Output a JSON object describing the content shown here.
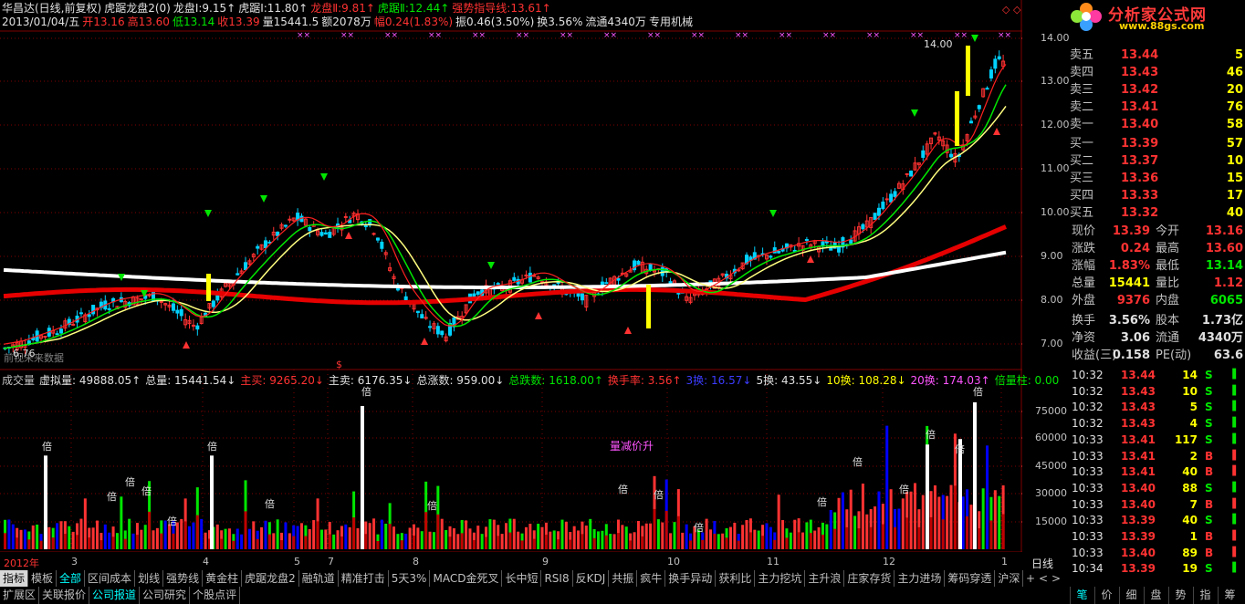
{
  "header": {
    "line1": [
      {
        "text": "华昌达(日线,前复权)",
        "color": "#e0e0e0"
      },
      {
        "text": "虎踞龙盘2(0)",
        "color": "#e0e0e0"
      },
      {
        "text": "龙盘Ⅰ:9.15↑",
        "color": "#e0e0e0"
      },
      {
        "text": "虎踞Ⅰ:11.80↑",
        "color": "#e0e0e0"
      },
      {
        "text": "龙盘Ⅱ:9.81↑",
        "color": "#ff3232"
      },
      {
        "text": "虎踞Ⅱ:12.44↑",
        "color": "#00e600"
      },
      {
        "text": "强势指导线:13.61↑",
        "color": "#ff3232"
      }
    ],
    "line2": [
      {
        "text": "2013/01/04/五",
        "color": "#e0e0e0"
      },
      {
        "text": "开13.16",
        "color": "#ff3232"
      },
      {
        "text": "高13.60",
        "color": "#ff3232"
      },
      {
        "text": "低13.14",
        "color": "#00e600"
      },
      {
        "text": "收13.39",
        "color": "#ff3232"
      },
      {
        "text": "量15441.5",
        "color": "#e0e0e0"
      },
      {
        "text": "额2078万",
        "color": "#e0e0e0"
      },
      {
        "text": "幅0.24(1.83%)",
        "color": "#ff3232"
      },
      {
        "text": "振0.46(3.50%)",
        "color": "#e0e0e0"
      },
      {
        "text": "换3.56%",
        "color": "#e0e0e0"
      },
      {
        "text": "流通4340万",
        "color": "#e0e0e0"
      },
      {
        "text": "专用机械",
        "color": "#e0e0e0"
      }
    ],
    "no_data_label": "前视未来数据",
    "max_label": "14.00",
    "min_label": "6.76",
    "dollar_mark": "$"
  },
  "logo": {
    "title": "分析家公式网",
    "url": "www.88gs.com"
  },
  "price_axis": [
    "14.00",
    "13.00",
    "12.00",
    "11.00",
    "10.00",
    "9.00",
    "8.00",
    "7.00"
  ],
  "volume_header": [
    {
      "text": "成交量",
      "color": "#c0c0c0"
    },
    {
      "text": "虚拟量: 49888.05↑",
      "color": "#e0e0e0"
    },
    {
      "text": "总量: 15441.54↓",
      "color": "#e0e0e0"
    },
    {
      "text": "主买: 9265.20↓",
      "color": "#ff3232"
    },
    {
      "text": "主卖: 6176.35↓",
      "color": "#e0e0e0"
    },
    {
      "text": "总涨数: 959.00↓",
      "color": "#e0e0e0"
    },
    {
      "text": "总跌数: 1618.00↑",
      "color": "#00e600"
    },
    {
      "text": "换手率: 3.56↑",
      "color": "#ff3232"
    },
    {
      "text": "3换: 16.57↓",
      "color": "#3c3cff"
    },
    {
      "text": "5换: 43.55↓",
      "color": "#e0e0e0"
    },
    {
      "text": "10换: 108.28↓",
      "color": "#ffff00"
    },
    {
      "text": "20换: 174.03↑",
      "color": "#ff55ff"
    },
    {
      "text": "倍量柱: 0.00",
      "color": "#00e600"
    }
  ],
  "volume_axis": [
    "75000",
    "60000",
    "45000",
    "30000",
    "15000"
  ],
  "volume_note": "量减价升",
  "bei_label": "倍",
  "time_axis": [
    {
      "label": "2012年",
      "color": "#ff3232"
    },
    {
      "label": "3",
      "color": "#c0c0c0"
    },
    {
      "label": "4",
      "color": "#c0c0c0"
    },
    {
      "label": "5",
      "color": "#c0c0c0"
    },
    {
      "label": "7",
      "color": "#c0c0c0"
    },
    {
      "label": "8",
      "color": "#c0c0c0"
    },
    {
      "label": "9",
      "color": "#c0c0c0"
    },
    {
      "label": "10",
      "color": "#c0c0c0"
    },
    {
      "label": "11",
      "color": "#c0c0c0"
    },
    {
      "label": "12",
      "color": "#c0c0c0"
    },
    {
      "label": "1",
      "color": "#c0c0c0"
    }
  ],
  "period_label": "日线",
  "sell_orders": [
    {
      "label": "卖五",
      "price": "13.44",
      "vol": "5"
    },
    {
      "label": "卖四",
      "price": "13.43",
      "vol": "46"
    },
    {
      "label": "卖三",
      "price": "13.42",
      "vol": "20"
    },
    {
      "label": "卖二",
      "price": "13.41",
      "vol": "76"
    },
    {
      "label": "卖一",
      "price": "13.40",
      "vol": "58"
    }
  ],
  "buy_orders": [
    {
      "label": "买一",
      "price": "13.39",
      "vol": "57"
    },
    {
      "label": "买二",
      "price": "13.37",
      "vol": "10"
    },
    {
      "label": "买三",
      "price": "13.36",
      "vol": "15"
    },
    {
      "label": "买四",
      "price": "13.33",
      "vol": "17"
    },
    {
      "label": "买五",
      "price": "13.32",
      "vol": "40"
    }
  ],
  "stats": [
    {
      "a": "现价",
      "b": "13.39",
      "bc": "#ff3232",
      "c": "今开",
      "d": "13.16",
      "dc": "#ff3232"
    },
    {
      "a": "涨跌",
      "b": "0.24",
      "bc": "#ff3232",
      "c": "最高",
      "d": "13.60",
      "dc": "#ff3232"
    },
    {
      "a": "涨幅",
      "b": "1.83%",
      "bc": "#ff3232",
      "c": "最低",
      "d": "13.14",
      "dc": "#00e600"
    },
    {
      "a": "总量",
      "b": "15441",
      "bc": "#ffff00",
      "c": "量比",
      "d": "1.12",
      "dc": "#ff3232"
    },
    {
      "a": "外盘",
      "b": "9376",
      "bc": "#ff3232",
      "c": "内盘",
      "d": "6065",
      "dc": "#00e600"
    }
  ],
  "stats2": [
    {
      "a": "换手",
      "b": "3.56%",
      "bc": "#e0e0e0",
      "c": "股本",
      "d": "1.73亿",
      "dc": "#e0e0e0"
    },
    {
      "a": "净资",
      "b": "3.06",
      "bc": "#e0e0e0",
      "c": "流通",
      "d": "4340万",
      "dc": "#e0e0e0"
    },
    {
      "a": "收益(三)",
      "b": "0.158",
      "bc": "#e0e0e0",
      "c": "PE(动)",
      "d": "63.6",
      "dc": "#e0e0e0"
    }
  ],
  "ticks": [
    {
      "t": "10:32",
      "p": "13.44",
      "pc": "#ff3232",
      "v": "14",
      "s": "S",
      "sc": "#00e600"
    },
    {
      "t": "10:32",
      "p": "13.43",
      "pc": "#ff3232",
      "v": "10",
      "s": "S",
      "sc": "#00e600"
    },
    {
      "t": "10:32",
      "p": "13.43",
      "pc": "#ff3232",
      "v": "5",
      "s": "S",
      "sc": "#00e600"
    },
    {
      "t": "10:32",
      "p": "13.43",
      "pc": "#ff3232",
      "v": "4",
      "s": "S",
      "sc": "#00e600"
    },
    {
      "t": "10:33",
      "p": "13.41",
      "pc": "#ff3232",
      "v": "117",
      "s": "S",
      "sc": "#00e600"
    },
    {
      "t": "10:33",
      "p": "13.41",
      "pc": "#ff3232",
      "v": "2",
      "s": "B",
      "sc": "#ff3232"
    },
    {
      "t": "10:33",
      "p": "13.41",
      "pc": "#ff3232",
      "v": "40",
      "s": "B",
      "sc": "#ff3232"
    },
    {
      "t": "10:33",
      "p": "13.40",
      "pc": "#ff3232",
      "v": "88",
      "s": "S",
      "sc": "#00e600"
    },
    {
      "t": "10:33",
      "p": "13.40",
      "pc": "#ff3232",
      "v": "7",
      "s": "B",
      "sc": "#ff3232"
    },
    {
      "t": "10:33",
      "p": "13.39",
      "pc": "#ff3232",
      "v": "40",
      "s": "S",
      "sc": "#00e600"
    },
    {
      "t": "10:33",
      "p": "13.39",
      "pc": "#ff3232",
      "v": "1",
      "s": "B",
      "sc": "#ff3232"
    },
    {
      "t": "10:33",
      "p": "13.40",
      "pc": "#ff3232",
      "v": "89",
      "s": "B",
      "sc": "#ff3232"
    },
    {
      "t": "10:34",
      "p": "13.39",
      "pc": "#ff3232",
      "v": "19",
      "s": "S",
      "sc": "#00e600"
    }
  ],
  "tabs": [
    {
      "label": "指标",
      "active": true,
      "hl": false
    },
    {
      "label": "模板",
      "active": false,
      "hl": false
    },
    {
      "label": "全部",
      "active": false,
      "hl": true
    },
    {
      "label": "区间成本",
      "active": false,
      "hl": false
    },
    {
      "label": "划线",
      "active": false,
      "hl": false
    },
    {
      "label": "强势线",
      "active": false,
      "hl": false
    },
    {
      "label": "黄金柱",
      "active": false,
      "hl": false
    },
    {
      "label": "虎踞龙盘2",
      "active": false,
      "hl": false
    },
    {
      "label": "融轨道",
      "active": false,
      "hl": false
    },
    {
      "label": "精准打击",
      "active": false,
      "hl": false
    },
    {
      "label": "5天3%",
      "active": false,
      "hl": false
    },
    {
      "label": "MACD金死叉",
      "active": false,
      "hl": false
    },
    {
      "label": "长中短",
      "active": false,
      "hl": false
    },
    {
      "label": "RSI8",
      "active": false,
      "hl": false
    },
    {
      "label": "反KDJ",
      "active": false,
      "hl": false
    },
    {
      "label": "共振",
      "active": false,
      "hl": false
    },
    {
      "label": "疯牛",
      "active": false,
      "hl": false
    },
    {
      "label": "换手异动",
      "active": false,
      "hl": false
    },
    {
      "label": "获利比",
      "active": false,
      "hl": false
    },
    {
      "label": "主力挖坑",
      "active": false,
      "hl": false
    },
    {
      "label": "主升浪",
      "active": false,
      "hl": false
    },
    {
      "label": "庄家存货",
      "active": false,
      "hl": false
    },
    {
      "label": "主力进场",
      "active": false,
      "hl": false
    },
    {
      "label": "筹码穿透",
      "active": false,
      "hl": false
    },
    {
      "label": "沪深",
      "active": false,
      "hl": false
    }
  ],
  "tab_ctrl": [
    "+",
    "<",
    ">"
  ],
  "tabs2": [
    {
      "label": "扩展区",
      "hl": false
    },
    {
      "label": "关联报价",
      "hl": false
    },
    {
      "label": "公司报道",
      "hl": true
    },
    {
      "label": "公司研究",
      "hl": false
    },
    {
      "label": "个股点评",
      "hl": false
    }
  ],
  "side_tabs": [
    "笔",
    "价",
    "细",
    "盘",
    "势",
    "指",
    "筹"
  ],
  "colors": {
    "up": "#ff3232",
    "down": "#00e600",
    "bg": "#000000",
    "grid": "#800000"
  }
}
